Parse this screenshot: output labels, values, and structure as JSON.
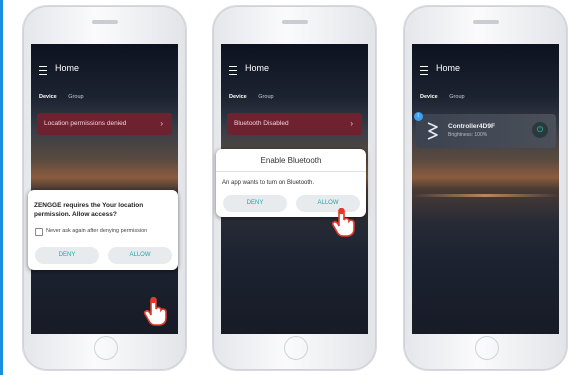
{
  "colors": {
    "accent": "#1fa6a6",
    "banner": "#6e2230",
    "pointer_hand": "#e03a2a",
    "power": "#32d1c1"
  },
  "phones": [
    {
      "title": "Home",
      "tabs": [
        "Device",
        "Group"
      ],
      "banner": "Location permissions denied",
      "banner_chevron": "›",
      "dialog": {
        "message": "ZENGGE requires the Your location permission. Allow access?",
        "checkbox_label": "Never ask again after denying permission",
        "deny": "DENY",
        "allow": "ALLOW"
      }
    },
    {
      "title": "Home",
      "tabs": [
        "Device",
        "Group"
      ],
      "banner": "Bluetooth Disabled",
      "banner_chevron": "›",
      "dialog": {
        "title": "Enable Bluetooth",
        "message": "An app wants to turn on Bluetooth.",
        "deny": "DENY",
        "allow": "ALLOW"
      }
    },
    {
      "title": "Home",
      "tabs": [
        "Device",
        "Group"
      ],
      "device": {
        "name": "Controller4D9F",
        "brightness": "Brightness: 100%",
        "badge_icon": "bluetooth-icon"
      }
    }
  ]
}
